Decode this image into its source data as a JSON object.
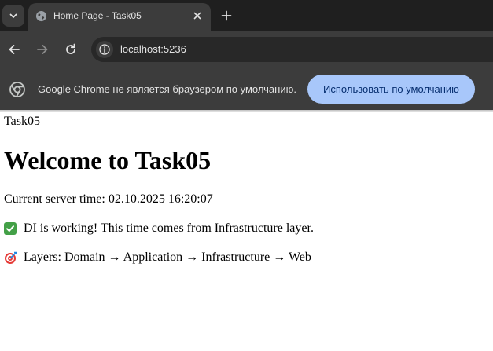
{
  "browser": {
    "tab": {
      "title": "Home Page - Task05"
    },
    "address_bar": {
      "url": "localhost:5236"
    },
    "infobar": {
      "message": "Google Chrome не является браузером по умолчанию.",
      "button_label": "Использовать по умолчанию"
    }
  },
  "page": {
    "brand": "Task05",
    "heading": "Welcome to Task05",
    "server_time_line": "Current server time: 02.10.2025 16:20:07",
    "di_line": "DI is working! This time comes from Infrastructure layer.",
    "layers_line": "Layers: Domain → Application → Infrastructure → Web"
  },
  "colors": {
    "tabstrip_bg": "#1f1f1f",
    "toolbar_bg": "#3c3c3c",
    "infobar_button_bg": "#a8c7fa",
    "check_green": "#43a047"
  },
  "icons": [
    "chevron-down-icon",
    "globe-icon",
    "close-icon",
    "plus-icon",
    "back-arrow-icon",
    "forward-arrow-icon",
    "reload-icon",
    "info-icon",
    "chrome-icon",
    "check-icon",
    "target-icon"
  ]
}
